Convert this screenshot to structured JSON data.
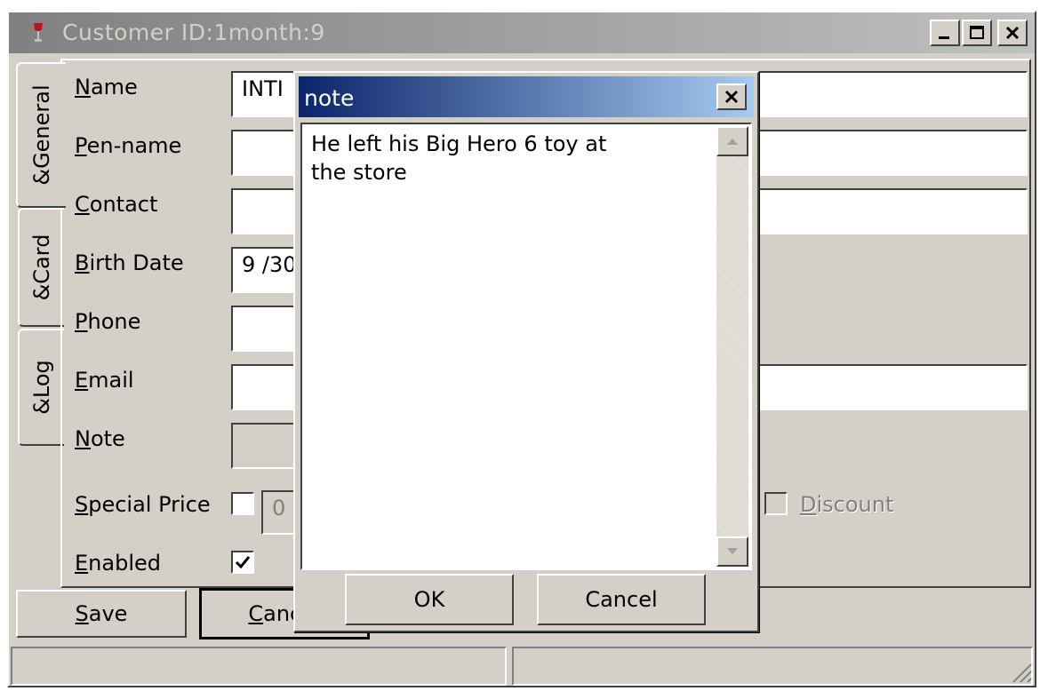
{
  "window": {
    "title": "Customer ID:1month:9",
    "controls": {
      "minimize": "_",
      "maximize": "□",
      "close": "✕"
    }
  },
  "tabs": [
    {
      "label": "&General",
      "active": true
    },
    {
      "label": "&Card",
      "active": false
    },
    {
      "label": "&Log",
      "active": false
    }
  ],
  "form": {
    "name": {
      "label_first": "N",
      "label_rest": "ame",
      "value": "INTI"
    },
    "pen_name": {
      "label_first": "P",
      "label_rest": "en-name",
      "value": ""
    },
    "contact": {
      "label_first": "C",
      "label_rest": "ontact",
      "value": ""
    },
    "birth_date": {
      "label_first": "B",
      "label_rest": "irth Date",
      "value": "9 /30"
    },
    "phone": {
      "label_first": "P",
      "label_rest": "hone",
      "value": ""
    },
    "email": {
      "label_first": "E",
      "label_rest": "mail",
      "value": ""
    },
    "note": {
      "label_first": "N",
      "label_rest": "ote",
      "value": ""
    },
    "special_price": {
      "label_first": "S",
      "label_rest": "pecial Price",
      "checked": false,
      "value": "0"
    },
    "discount": {
      "label_first": "D",
      "label_rest": "iscount",
      "checked": false
    },
    "enabled": {
      "label_first": "E",
      "label_rest": "nabled",
      "checked": true
    }
  },
  "buttons": {
    "save_first": "S",
    "save_rest": "ave",
    "cancel_first": "C",
    "cancel_rest": "ancel"
  },
  "dialog": {
    "title": "note",
    "text": "He left his Big Hero 6 toy at\nthe store",
    "ok_label": "OK",
    "cancel_label": "Cancel"
  },
  "status_bar": {
    "left": "",
    "right": ""
  },
  "colors": {
    "face": "#d4d0c8",
    "active_title_start": "#0a246a",
    "active_title_end": "#a6caf0",
    "inactive_title_start": "#808080",
    "inactive_title_end": "#c0c0c0"
  }
}
